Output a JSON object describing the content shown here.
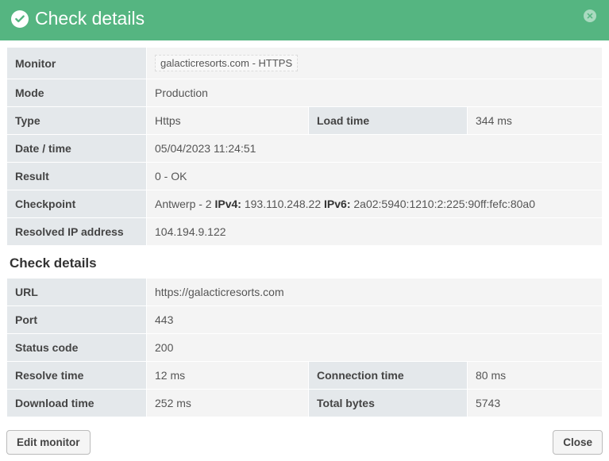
{
  "header": {
    "title": "Check details"
  },
  "section2_title": "Check details",
  "labels": {
    "monitor": "Monitor",
    "mode": "Mode",
    "type": "Type",
    "loadtime": "Load time",
    "datetime": "Date / time",
    "result": "Result",
    "checkpoint": "Checkpoint",
    "resolved": "Resolved IP address",
    "url": "URL",
    "port": "Port",
    "status": "Status code",
    "resolvetime": "Resolve time",
    "conntime": "Connection time",
    "dltime": "Download time",
    "totalbytes": "Total bytes"
  },
  "values": {
    "monitor": "galacticresorts.com - HTTPS",
    "mode": "Production",
    "type": "Https",
    "loadtime": "344 ms",
    "datetime": "05/04/2023 11:24:51",
    "result": "0 - OK",
    "checkpoint_prefix": "Antwerp - 2 ",
    "ipv4_label": "IPv4:",
    "ipv4_value": " 193.110.248.22 ",
    "ipv6_label": "IPv6:",
    "ipv6_value": " 2a02:5940:1210:2:225:90ff:fefc:80a0",
    "resolved": "104.194.9.122",
    "url": "https://galacticresorts.com",
    "port": "443",
    "status": "200",
    "resolvetime": "12 ms",
    "conntime": "80 ms",
    "dltime": "252 ms",
    "totalbytes": "5743"
  },
  "buttons": {
    "edit": "Edit monitor",
    "close": "Close"
  }
}
